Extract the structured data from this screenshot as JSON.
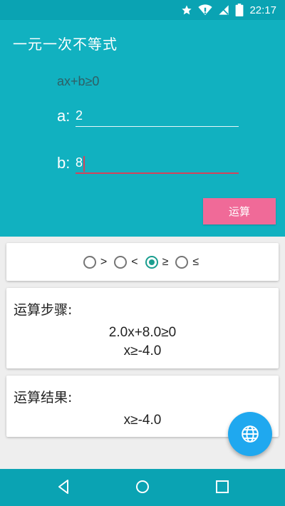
{
  "status_bar": {
    "time": "22:17",
    "icons": [
      "star-icon",
      "wifi-icon",
      "no-signal-icon",
      "battery-icon"
    ]
  },
  "app_bar": {
    "title": "一元一次不等式"
  },
  "form": {
    "formula": "ax+b≥0",
    "a_label": "a:",
    "a_value": "2",
    "b_label": "b:",
    "b_value": "8",
    "calculate_label": "运算"
  },
  "operators": {
    "options": [
      {
        "symbol": ">",
        "checked": false
      },
      {
        "symbol": "<",
        "checked": false
      },
      {
        "symbol": "≥",
        "checked": true
      },
      {
        "symbol": "≤",
        "checked": false
      }
    ]
  },
  "steps": {
    "heading": "运算步骤:",
    "lines": [
      "2.0x+8.0≥0",
      "x≥-4.0"
    ]
  },
  "result": {
    "heading": "运算结果:",
    "value": "x≥-4.0"
  },
  "fab": {
    "icon": "globe-icon"
  },
  "nav_bar": {
    "icons": [
      "back-icon",
      "home-icon",
      "recents-icon"
    ]
  },
  "colors": {
    "primary": "#11b1c0",
    "primary_dark": "#0aa3b3",
    "accent": "#f06a98",
    "focus_underline": "#d2445c",
    "radio_checked": "#1a9e8f",
    "fab": "#1fa8ef"
  }
}
